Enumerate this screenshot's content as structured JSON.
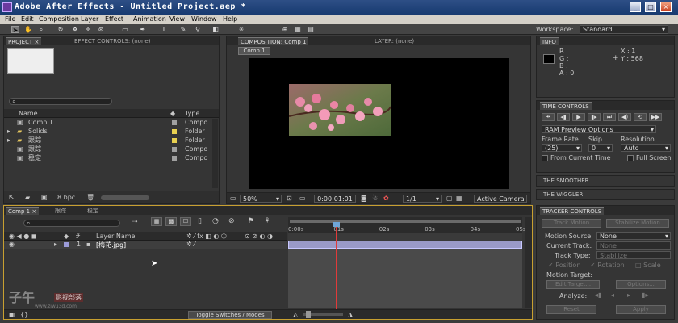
{
  "window": {
    "title": "Adobe After Effects - Untitled Project.aep *",
    "min": "_",
    "max": "□",
    "close": "×"
  },
  "menu": [
    "File",
    "Edit",
    "Composition",
    "Layer",
    "Effect",
    "Animation",
    "View",
    "Window",
    "Help"
  ],
  "toolbar": {
    "workspace_label": "Workspace:",
    "workspace_value": "Standard"
  },
  "project_panel": {
    "tabs": [
      "PROJECT ×",
      "EFFECT CONTROLS: (none)"
    ],
    "columns": {
      "name": "Name",
      "type": "Type"
    },
    "items": [
      {
        "name": "Comp 1",
        "type": "Compo",
        "color": "#a0a0a0"
      },
      {
        "name": "Solids",
        "type": "Folder",
        "color": "#e8d050"
      },
      {
        "name": "跟踪",
        "type": "Folder",
        "color": "#e8d050"
      },
      {
        "name": "跟踪",
        "type": "Compo",
        "color": "#a0a0a0"
      },
      {
        "name": "稳定",
        "type": "Compo",
        "color": "#a0a0a0"
      }
    ],
    "bpc": "8 bpc"
  },
  "composition_panel": {
    "tab": "COMPOSITION: Comp 1",
    "layer_tab": "LAYER: (none)",
    "comp_button": "Comp 1",
    "zoom": "50%",
    "timecode": "0:00:01:01",
    "resolution": "1/1",
    "camera": "Active Camera"
  },
  "info_panel": {
    "tab": "INFO",
    "r": "R :",
    "g": "G :",
    "b": "B :",
    "a": "A : 0",
    "x": "X : 1",
    "y": "Y : 568"
  },
  "time_controls": {
    "tab": "TIME CONTROLS",
    "ram_preview": "RAM Preview Options",
    "frame_rate_label": "Frame Rate",
    "frame_rate": "(25)",
    "skip_label": "Skip",
    "skip": "0",
    "resolution_label": "Resolution",
    "resolution": "Auto",
    "from_current": "From Current Time",
    "full_screen": "Full Screen"
  },
  "smoother": {
    "tab": "THE SMOOTHER"
  },
  "wiggler": {
    "tab": "THE WIGGLER"
  },
  "tracker": {
    "tab": "TRACKER CONTROLS",
    "track_motion": "Track Motion",
    "stabilize_motion": "Stabilize Motion",
    "motion_source_label": "Motion Source:",
    "motion_source": "None",
    "current_track_label": "Current Track:",
    "current_track": "None",
    "track_type_label": "Track Type:",
    "track_type": "Stabilize",
    "position": "Position",
    "rotation": "Rotation",
    "scale": "Scale",
    "motion_target": "Motion Target:",
    "edit_target": "Edit Target...",
    "options": "Options...",
    "analyze": "Analyze:",
    "reset": "Reset",
    "apply": "Apply"
  },
  "timeline": {
    "tabs": [
      "Comp 1 ×",
      "跟踪",
      "稳定"
    ],
    "layer_name_col": "Layer Name",
    "layer_index": "1",
    "layer_name": "[梅花.jpg]",
    "ticks": [
      "0:00s",
      "01s",
      "02s",
      "03s",
      "04s",
      "05s"
    ],
    "toggle_label": "Toggle Switches / Modes"
  },
  "watermark": {
    "logo": "子午",
    "sub": "影视部落",
    "url": "www.ziwu3d.com"
  }
}
